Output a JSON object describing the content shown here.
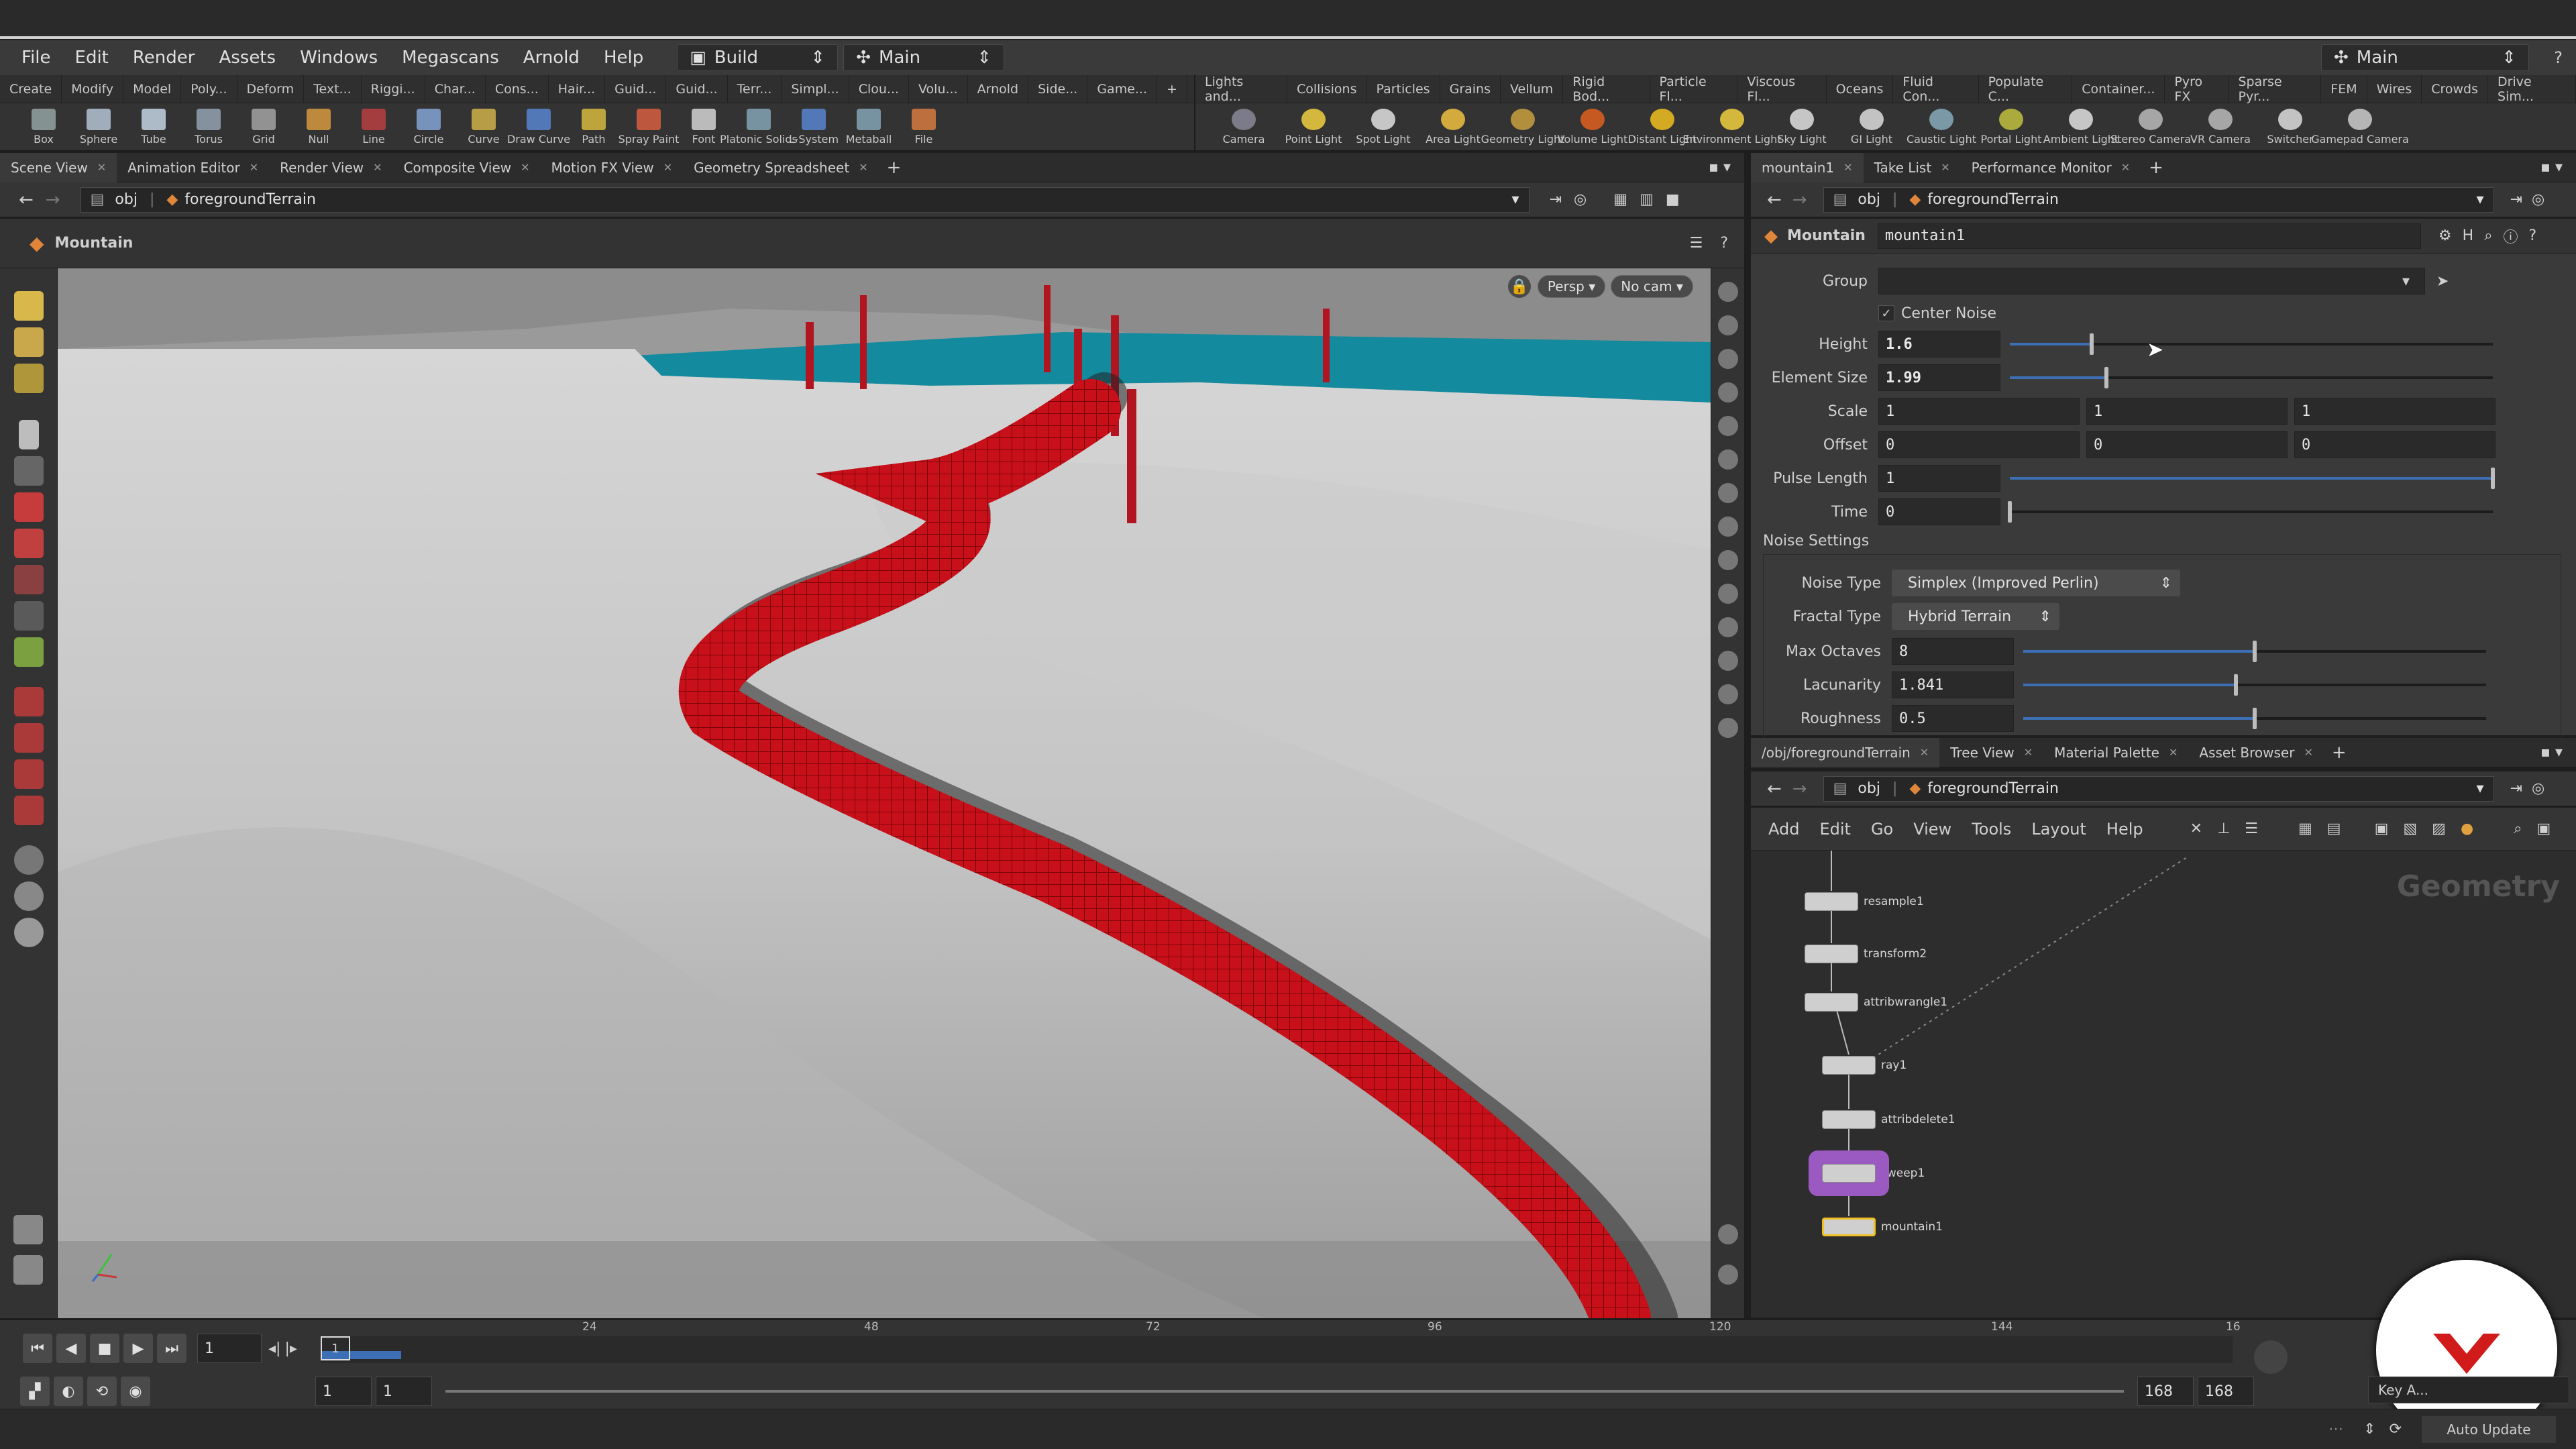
{
  "menu": [
    "File",
    "Edit",
    "Render",
    "Assets",
    "Windows",
    "Megascans",
    "Arnold",
    "Help"
  ],
  "desktop": {
    "build": "Build",
    "main": "Main",
    "right_main": "Main"
  },
  "shelf_tabs_left": [
    "Create",
    "Modify",
    "Model",
    "Poly...",
    "Deform",
    "Text...",
    "Riggi...",
    "Char...",
    "Cons...",
    "Hair...",
    "Guid...",
    "Guid...",
    "Terr...",
    "Simpl...",
    "Clou...",
    "Volu...",
    "Arnold",
    "Side...",
    "Game..."
  ],
  "shelf_tabs_right": [
    "Lights and...",
    "Collisions",
    "Particles",
    "Grains",
    "Vellum",
    "Rigid Bod...",
    "Particle Fl...",
    "Viscous Fl...",
    "Oceans",
    "Fluid Con...",
    "Populate C...",
    "Container...",
    "Pyro FX",
    "Sparse Pyr...",
    "FEM",
    "Wires",
    "Crowds",
    "Drive Sim..."
  ],
  "tools_left": [
    "Box",
    "Sphere",
    "Tube",
    "Torus",
    "Grid",
    "Null",
    "Line",
    "Circle",
    "Curve",
    "Draw Curve",
    "Path",
    "Spray Paint",
    "Font",
    "Platonic Solids",
    "L-System",
    "Metaball",
    "File"
  ],
  "tools_right": [
    "Camera",
    "Point Light",
    "Spot Light",
    "Area Light",
    "Geometry Light",
    "Volume Light",
    "Distant Light",
    "Environment Light",
    "Sky Light",
    "GI Light",
    "Caustic Light",
    "Portal Light",
    "Ambient Light",
    "Stereo Camera",
    "VR Camera",
    "Switcher",
    "Gamepad Camera"
  ],
  "viewer_tabs": [
    "Scene View",
    "Animation Editor",
    "Render View",
    "Composite View",
    "Motion FX View",
    "Geometry Spreadsheet"
  ],
  "viewer": {
    "path_root": "obj",
    "path_node": "foregroundTerrain",
    "title": "Mountain",
    "persp_label": "Persp",
    "cam_label": "No cam"
  },
  "param_tabs": [
    "mountain1",
    "Take List",
    "Performance Monitor"
  ],
  "params": {
    "path_root": "obj",
    "path_node": "foregroundTerrain",
    "node_type": "Mountain",
    "node_name": "mountain1",
    "group_label": "Group",
    "center_noise_label": "Center Noise",
    "height": {
      "label": "Height",
      "value": "1.6",
      "slider": 0.17
    },
    "element_size": {
      "label": "Element Size",
      "value": "1.99",
      "slider": 0.2
    },
    "scale": {
      "label": "Scale",
      "values": [
        "1",
        "1",
        "1"
      ]
    },
    "offset": {
      "label": "Offset",
      "values": [
        "0",
        "0",
        "0"
      ]
    },
    "pulse_length": {
      "label": "Pulse Length",
      "value": "1",
      "slider": 1.0
    },
    "time": {
      "label": "Time",
      "value": "0",
      "slider": 0.0
    },
    "noise_settings_label": "Noise Settings",
    "noise_type": {
      "label": "Noise Type",
      "value": "Simplex (Improved Perlin)"
    },
    "fractal_type": {
      "label": "Fractal Type",
      "value": "Hybrid Terrain"
    },
    "max_octaves": {
      "label": "Max Octaves",
      "value": "8",
      "slider": 0.5
    },
    "lacunarity": {
      "label": "Lacunarity",
      "value": "1.841",
      "slider": 0.46
    },
    "roughness": {
      "label": "Roughness",
      "value": "0.5",
      "slider": 0.5
    }
  },
  "network_tabs": [
    "/obj/foregroundTerrain",
    "Tree View",
    "Material Palette",
    "Asset Browser"
  ],
  "network": {
    "path_root": "obj",
    "path_node": "foregroundTerrain",
    "menus": [
      "Add",
      "Edit",
      "Go",
      "View",
      "Tools",
      "Layout",
      "Help"
    ],
    "context_label": "Geometry",
    "nodes": [
      "resample1",
      "transform2",
      "attribwrangle1",
      "ray1",
      "attribdelete1",
      "sweep1",
      "mountain1"
    ]
  },
  "timeline": {
    "ticks": [
      "24",
      "48",
      "72",
      "96",
      "120",
      "144",
      "16"
    ],
    "current_frame": "1",
    "playhead_label": "1",
    "range_start": "1",
    "range_start2": "1",
    "range_end": "168",
    "range_end2": "168"
  },
  "status": {
    "keys_label": "Key A...",
    "auto_update": "Auto Update"
  },
  "colors": {
    "accent": "#3c6fb5",
    "path_red": "#c8101a",
    "water": "#138a9e",
    "snow": "#c9c9c9",
    "node_selected": "#f0c020"
  }
}
